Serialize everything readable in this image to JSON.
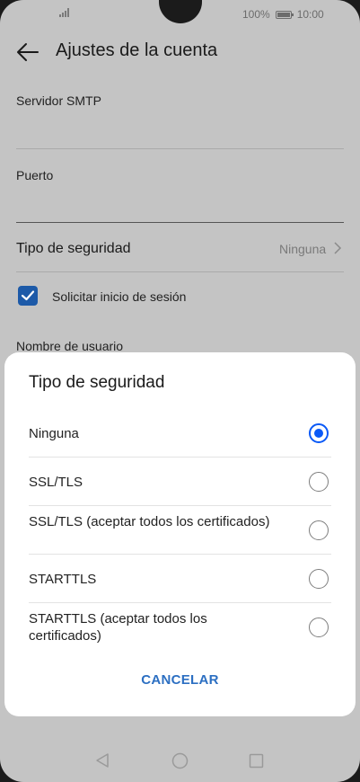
{
  "status_bar": {
    "battery_percent": "100%",
    "time": "10:00"
  },
  "header": {
    "title": "Ajustes de la cuenta"
  },
  "settings": {
    "smtp_server_label": "Servidor SMTP",
    "port_label": "Puerto",
    "security_type_label": "Tipo de seguridad",
    "security_type_value": "Ninguna",
    "require_login_label": "Solicitar inicio de sesión",
    "require_login_checked": true,
    "username_label": "Nombre de usuario"
  },
  "dialog": {
    "title": "Tipo de seguridad",
    "options": [
      {
        "label": "Ninguna",
        "selected": true
      },
      {
        "label": "SSL/TLS",
        "selected": false
      },
      {
        "label": "SSL/TLS (aceptar todos los certificados)",
        "selected": false
      },
      {
        "label": "STARTTLS",
        "selected": false
      },
      {
        "label": "STARTTLS (aceptar todos los certificados)",
        "selected": false
      }
    ],
    "cancel_label": "CANCELAR"
  },
  "colors": {
    "accent": "#0a59f7",
    "checkbox": "#1d5aa8",
    "cancel_text": "#2c6fc2"
  },
  "icons": [
    "signal-icon",
    "battery-icon",
    "back-arrow-icon",
    "chevron-right-icon",
    "checkmark-icon",
    "nav-back-icon",
    "nav-home-icon",
    "nav-recents-icon"
  ]
}
